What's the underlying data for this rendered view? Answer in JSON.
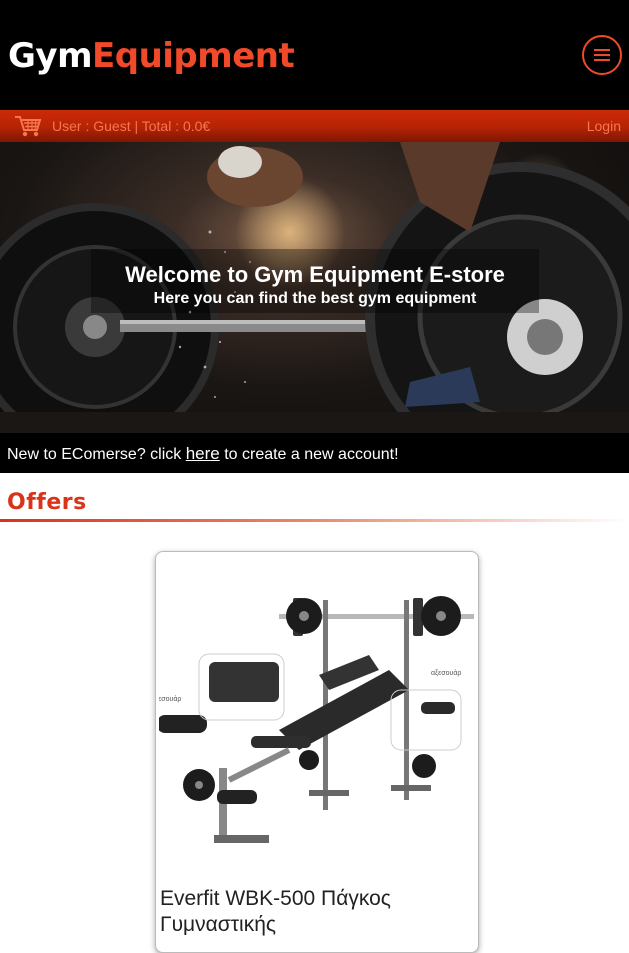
{
  "header": {
    "logo_part1": "Gym",
    "logo_part2": "Equipment"
  },
  "userbar": {
    "user_info": "User : Guest | Total : 0.0€",
    "login_label": "Login"
  },
  "hero": {
    "title": "Welcome to Gym Equipment E-store",
    "subtitle": "Here you can find the best gym equipment"
  },
  "signup": {
    "prefix": "New to EComerse? click ",
    "link": "here",
    "suffix": " to create a new account!"
  },
  "offers": {
    "heading": "Offers",
    "products": [
      {
        "name": "Everfit WBK-500 Πάγκος Γυμναστικής",
        "image_labels": [
          "αξεσουάρ",
          "αξεσουάρ"
        ]
      }
    ]
  },
  "colors": {
    "accent": "#f04a2a",
    "bar": "#b52305",
    "background": "#000000"
  }
}
